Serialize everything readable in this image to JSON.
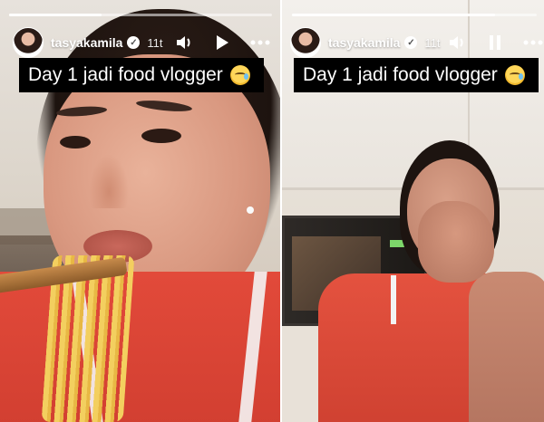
{
  "stories": [
    {
      "username": "tasyakamila",
      "time": "11t",
      "caption": "Day 1 jadi food vlogger",
      "caption_emoji": "face-holding-back-tears-icon",
      "play_state": "play",
      "progress": 0.35
    },
    {
      "username": "tasyakamila",
      "time": "11t",
      "caption": "Day 1 jadi food vlogger",
      "caption_emoji": "face-holding-back-tears-icon",
      "play_state": "pause",
      "progress": 0.83
    }
  ],
  "colors": {
    "overlay_text": "#ffffff",
    "caption_bg": "#000000",
    "shirt": "#d9463a"
  }
}
